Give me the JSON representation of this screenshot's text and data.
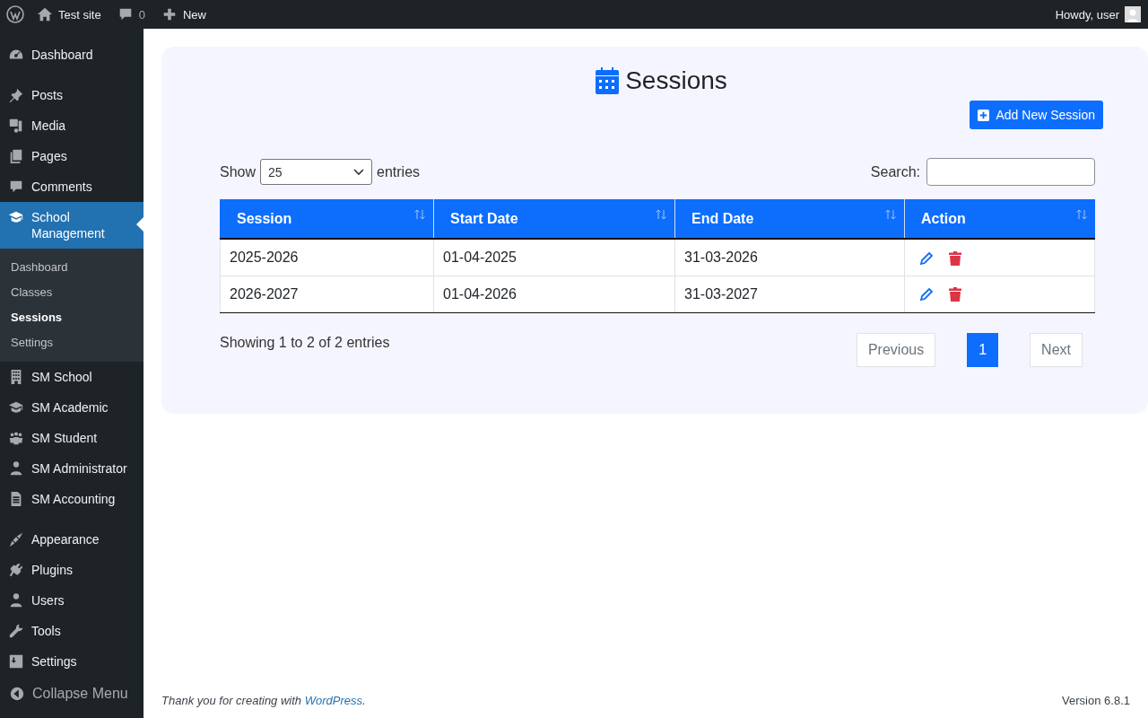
{
  "admin_bar": {
    "site": "Test site",
    "comments_count": "0",
    "new_label": "New",
    "greeting": "Howdy, user"
  },
  "sidebar": {
    "items": [
      {
        "kind": "item",
        "label": "Dashboard",
        "selected": false
      },
      {
        "kind": "gap"
      },
      {
        "kind": "item",
        "label": "Posts",
        "selected": false
      },
      {
        "kind": "item",
        "label": "Media",
        "selected": false
      },
      {
        "kind": "item",
        "label": "Pages",
        "selected": false
      },
      {
        "kind": "item",
        "label": "Comments",
        "selected": false
      },
      {
        "kind": "item",
        "label": "School Management",
        "selected": true,
        "children": [
          {
            "label": "Dashboard",
            "selected": false
          },
          {
            "label": "Classes",
            "selected": false
          },
          {
            "label": "Sessions",
            "selected": true
          },
          {
            "label": "Settings",
            "selected": false
          }
        ]
      },
      {
        "kind": "item",
        "label": "SM School",
        "selected": false
      },
      {
        "kind": "item",
        "label": "SM Academic",
        "selected": false
      },
      {
        "kind": "item",
        "label": "SM Student",
        "selected": false
      },
      {
        "kind": "item",
        "label": "SM Administrator",
        "selected": false
      },
      {
        "kind": "item",
        "label": "SM Accounting",
        "selected": false
      },
      {
        "kind": "gap"
      },
      {
        "kind": "item",
        "label": "Appearance",
        "selected": false
      },
      {
        "kind": "item",
        "label": "Plugins",
        "selected": false
      },
      {
        "kind": "item",
        "label": "Users",
        "selected": false
      },
      {
        "kind": "item",
        "label": "Tools",
        "selected": false
      },
      {
        "kind": "item",
        "label": "Settings",
        "selected": false
      }
    ],
    "collapse": "Collapse Menu"
  },
  "page": {
    "title": "Sessions",
    "add_button": "Add New Session",
    "show_label": "Show",
    "page_length": "25",
    "entries_label": "entries",
    "search_label": "Search:",
    "table": {
      "columns": [
        "Session",
        "Start Date",
        "End Date",
        "Action"
      ],
      "rows": [
        {
          "session": "2025-2026",
          "start": "01-04-2025",
          "end": "31-03-2026"
        },
        {
          "session": "2026-2027",
          "start": "01-04-2026",
          "end": "31-03-2027"
        }
      ]
    },
    "info": "Showing 1 to 2 of 2 entries",
    "pagination": [
      {
        "label": "Previous",
        "selected": false
      },
      {
        "label": "1",
        "selected": true
      },
      {
        "label": "Next",
        "selected": false
      }
    ]
  },
  "footer": {
    "thanks": "*Thank you for creating with* ",
    "link": "WordPress",
    "after": "*.*",
    "version": "Version 6.8.1"
  }
}
